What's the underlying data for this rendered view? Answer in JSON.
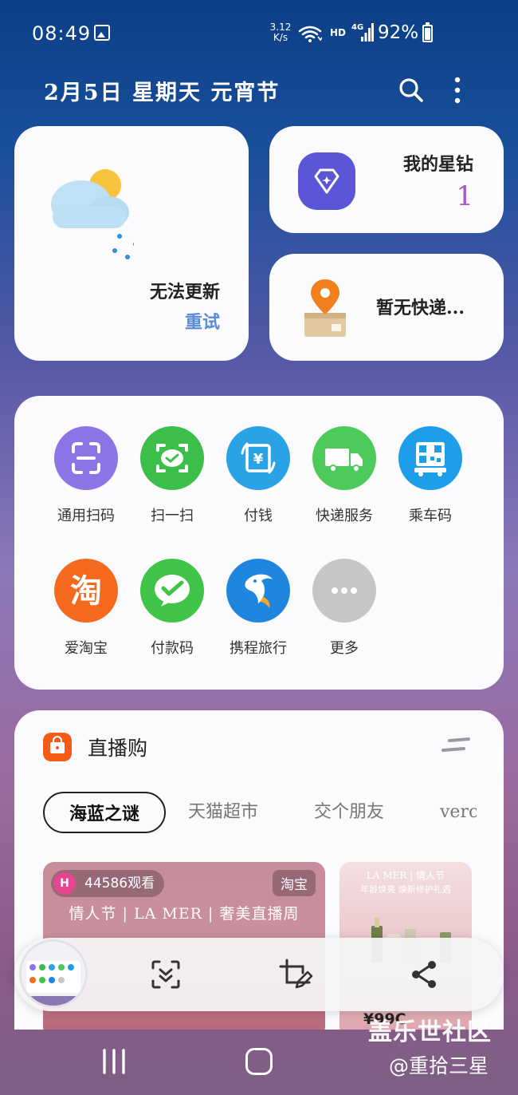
{
  "status_bar": {
    "time": "08:49",
    "net_speed_value": "3.12",
    "net_speed_unit": "K/s",
    "hd": "HD",
    "network": "4G",
    "battery": "92%"
  },
  "header": {
    "date_text": "2月5日 星期天 元宵节"
  },
  "weather_card": {
    "status": "无法更新",
    "retry": "重试"
  },
  "diamond_card": {
    "label": "我的星钻",
    "count": "1"
  },
  "express_card": {
    "label": "暂无快递..."
  },
  "apps": [
    {
      "label": "通用扫码",
      "color": "#8d74e6",
      "icon": "scan-icon"
    },
    {
      "label": "扫一扫",
      "color": "#3bbf4a",
      "icon": "wechat-scan-icon"
    },
    {
      "label": "付钱",
      "color": "#2aa2e6",
      "icon": "yuan-pay-icon"
    },
    {
      "label": "快递服务",
      "color": "#4ccb5a",
      "icon": "truck-icon"
    },
    {
      "label": "乘车码",
      "color": "#1e9de8",
      "icon": "bus-qr-icon"
    },
    {
      "label": "爱淘宝",
      "color": "#f5691f",
      "icon": "taobao-icon"
    },
    {
      "label": "付款码",
      "color": "#3fc447",
      "icon": "wechat-pay-icon"
    },
    {
      "label": "携程旅行",
      "color": "#1f86e0",
      "icon": "ctrip-dolphin-icon"
    },
    {
      "label": "更多",
      "color": "#c6c6c8",
      "icon": "more-dots-icon"
    }
  ],
  "live": {
    "title": "直播购",
    "tabs": [
      "海蓝之谜",
      "天猫超市",
      "交个朋友",
      "verc"
    ],
    "viewers": "44586观看",
    "viewer_logo": "H",
    "platform": "淘宝",
    "banner": "情人节 | LA MER | 奢美直播周",
    "thumb2_brand": "LA MER | 情人节",
    "thumb2_sub": "年龄焕亮 焕新修护礼遇",
    "price": "¥99C"
  },
  "watermark": {
    "main": "盖乐世社区",
    "sub": "@重拾三星"
  },
  "colors": {
    "accent_retry": "#5b8ad6",
    "diamond_count": "#a35ac2",
    "diamond_icon_bg": "#5b56d6"
  }
}
